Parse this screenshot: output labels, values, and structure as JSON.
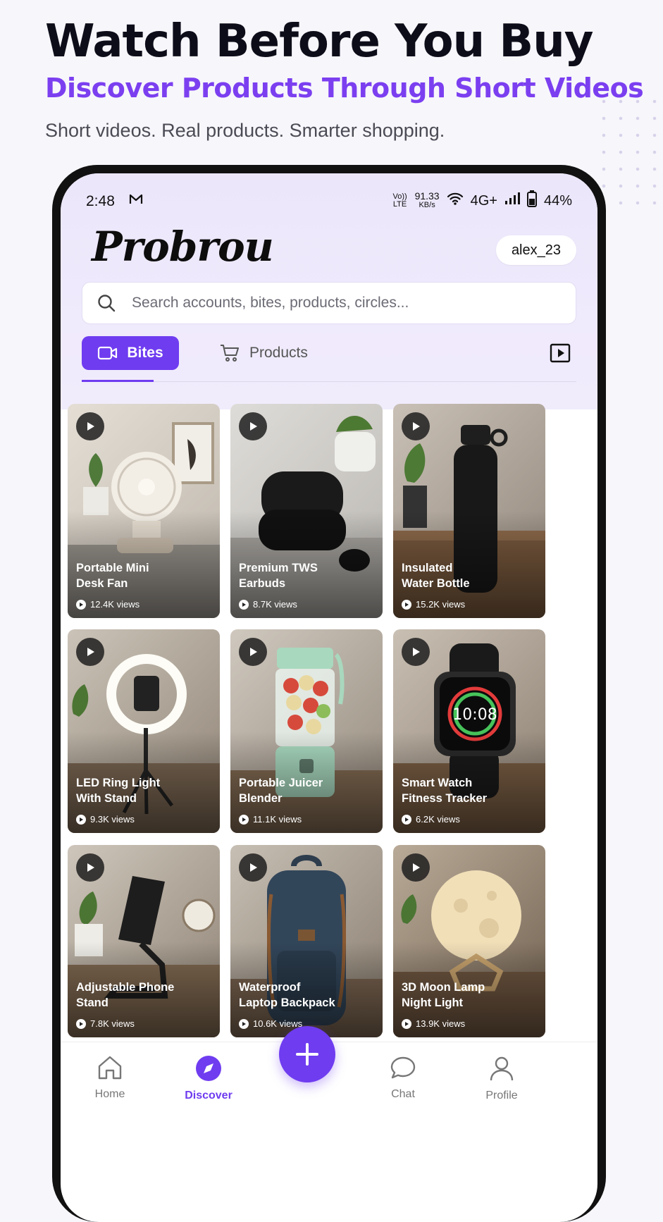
{
  "hero": {
    "title": "Watch Before You Buy",
    "subtitle": "Discover Products Through Short Videos",
    "tagline": "Short videos. Real products. Smarter shopping."
  },
  "status_bar": {
    "time": "2:48",
    "volte": "Vo)) LTE",
    "speed_value": "91.33",
    "speed_unit": "KB/s",
    "network": "4G+",
    "battery": "44%"
  },
  "app": {
    "logo": "Probrou",
    "username": "alex_23",
    "search_placeholder": "Search accounts, bites, products, circles..."
  },
  "tabs": {
    "bites": "Bites",
    "products": "Products"
  },
  "cards": [
    {
      "title": "Portable Mini\nDesk Fan",
      "views": "12.4K views"
    },
    {
      "title": "Premium TWS\nEarbuds",
      "views": "8.7K views"
    },
    {
      "title": "Insulated\nWater Bottle",
      "views": "15.2K views"
    },
    {
      "title": "LED Ring Light\nWith Stand",
      "views": "9.3K views"
    },
    {
      "title": "Portable Juicer\nBlender",
      "views": "11.1K views"
    },
    {
      "title": "Smart Watch\nFitness Tracker",
      "views": "6.2K views"
    },
    {
      "title": "Adjustable Phone\nStand",
      "views": "7.8K views"
    },
    {
      "title": "Waterproof\nLaptop Backpack",
      "views": "10.6K views"
    },
    {
      "title": "3D Moon Lamp\nNight Light",
      "views": "13.9K views"
    }
  ],
  "watch_time": "10:08",
  "nav": {
    "home": "Home",
    "discover": "Discover",
    "chat": "Chat",
    "profile": "Profile"
  },
  "colors": {
    "accent": "#6f3cf0",
    "hero_accent": "#7b3ff0"
  }
}
